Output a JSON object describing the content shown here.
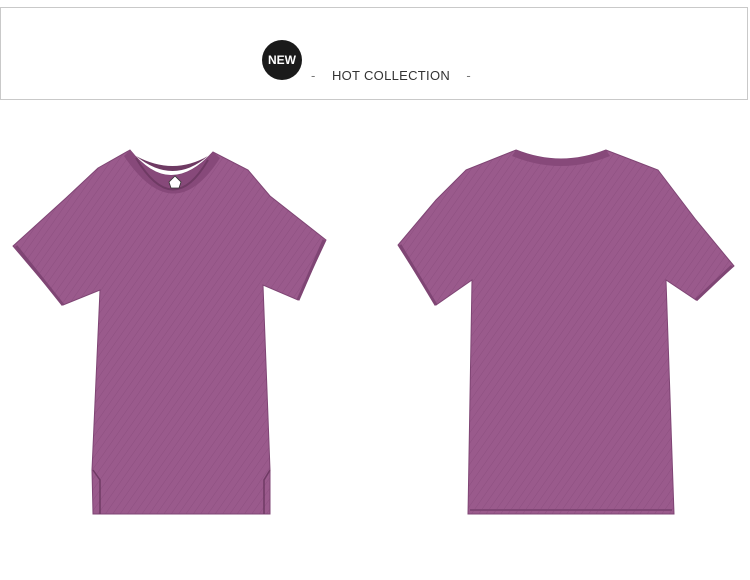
{
  "banner": {
    "badge_text": "NEW",
    "headline_text": "HOT COLLECTION",
    "dash_left": "-",
    "dash_right": "-"
  },
  "products": [
    {
      "view": "front",
      "neck": "v-neck",
      "color": "#9a5a8c"
    },
    {
      "view": "back",
      "neck": "crew-neck",
      "color": "#9a5a8c"
    }
  ],
  "colors": {
    "shirt": "#9a5a8c",
    "shirt_shadow": "#7f4574",
    "badge": "#1a1a1a"
  }
}
